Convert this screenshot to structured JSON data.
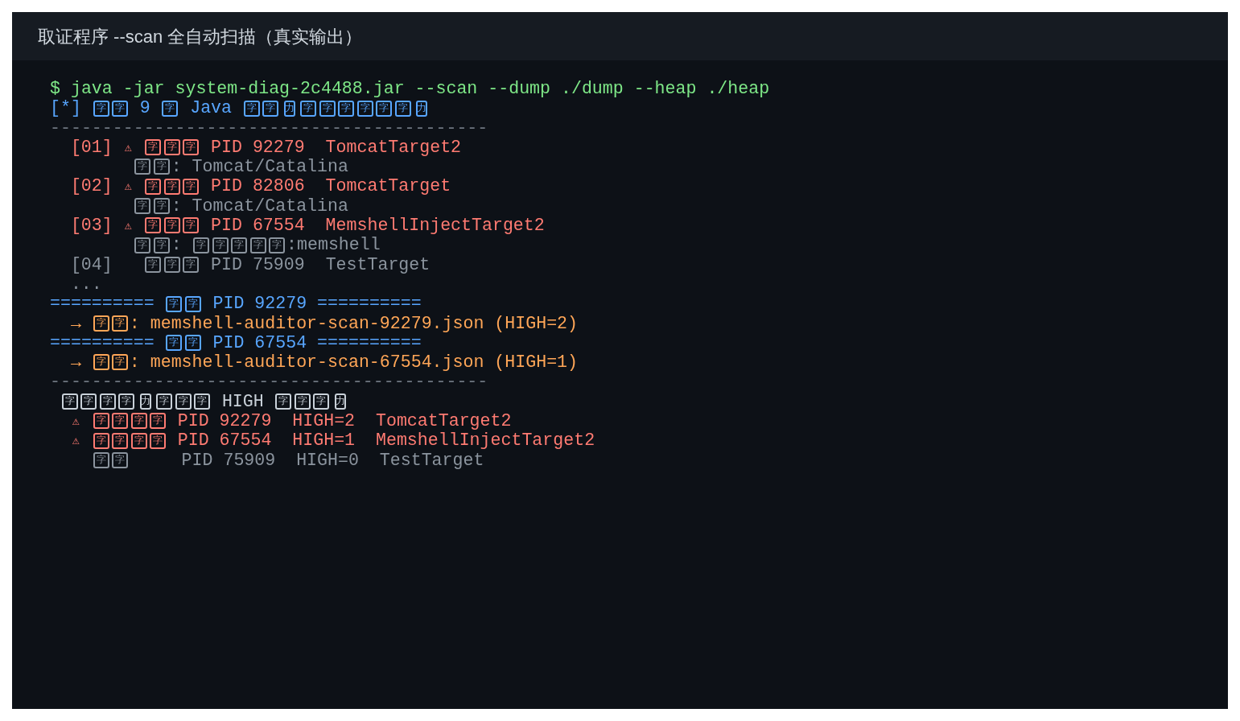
{
  "window": {
    "title": "取证程序 --scan 全自动扫描（真实输出）"
  },
  "terminal": {
    "lines": [
      {
        "kind": "command",
        "parts": [
          {
            "kind": "text",
            "text": "$ java -jar system-diag-2c4488.jar --scan --dump ./dump --heap ./heap"
          }
        ]
      },
      {
        "kind": "info",
        "parts": [
          {
            "kind": "text",
            "text": "[*] "
          },
          {
            "kind": "missing-glyph",
            "text": "字字"
          },
          {
            "kind": "text",
            "text": " 9 "
          },
          {
            "kind": "missing-glyph",
            "text": "字"
          },
          {
            "kind": "text",
            "text": " Java "
          },
          {
            "kind": "missing-glyph",
            "text": "字字"
          },
          {
            "kind": "narrow-glyph",
            "text": "力"
          },
          {
            "kind": "missing-glyph",
            "text": "字字字字字字"
          },
          {
            "kind": "narrow-glyph",
            "text": "力"
          }
        ]
      },
      {
        "kind": "rule",
        "parts": [
          {
            "kind": "text",
            "text": "------------------------------------------"
          }
        ]
      },
      {
        "kind": "alert-entry",
        "parts": [
          {
            "kind": "text",
            "text": "[01] "
          },
          {
            "kind": "symbol",
            "text": "⚠"
          },
          {
            "kind": "missing-glyph",
            "text": "字字字"
          },
          {
            "kind": "text",
            "text": " PID 92279  TomcatTarget2"
          }
        ]
      },
      {
        "kind": "detail",
        "parts": [
          {
            "kind": "missing-glyph",
            "text": "字字"
          },
          {
            "kind": "text",
            "text": ": Tomcat/Catalina"
          }
        ]
      },
      {
        "kind": "alert-entry",
        "parts": [
          {
            "kind": "text",
            "text": "[02] "
          },
          {
            "kind": "symbol",
            "text": "⚠"
          },
          {
            "kind": "missing-glyph",
            "text": "字字字"
          },
          {
            "kind": "text",
            "text": " PID 82806  TomcatTarget"
          }
        ]
      },
      {
        "kind": "detail",
        "parts": [
          {
            "kind": "missing-glyph",
            "text": "字字"
          },
          {
            "kind": "text",
            "text": ": Tomcat/Catalina"
          }
        ]
      },
      {
        "kind": "alert-entry",
        "parts": [
          {
            "kind": "text",
            "text": "[03] "
          },
          {
            "kind": "symbol",
            "text": "⚠"
          },
          {
            "kind": "missing-glyph",
            "text": "字字字"
          },
          {
            "kind": "text",
            "text": " PID 67554  MemshellInjectTarget2"
          }
        ]
      },
      {
        "kind": "detail",
        "parts": [
          {
            "kind": "missing-glyph",
            "text": "字字"
          },
          {
            "kind": "text",
            "text": ": "
          },
          {
            "kind": "missing-glyph",
            "text": "字字字字字"
          },
          {
            "kind": "text",
            "text": ":memshell"
          }
        ]
      },
      {
        "kind": "entry",
        "parts": [
          {
            "kind": "text",
            "text": "[04]   "
          },
          {
            "kind": "missing-glyph",
            "text": "字字字"
          },
          {
            "kind": "text",
            "text": " PID 75909  TestTarget"
          }
        ]
      },
      {
        "kind": "more",
        "parts": [
          {
            "kind": "text",
            "text": "..."
          }
        ]
      },
      {
        "kind": "section",
        "parts": [
          {
            "kind": "text",
            "text": "========== "
          },
          {
            "kind": "missing-glyph",
            "text": "字字"
          },
          {
            "kind": "text",
            "text": " PID 92279 =========="
          }
        ]
      },
      {
        "kind": "output",
        "parts": [
          {
            "kind": "text",
            "text": "→ "
          },
          {
            "kind": "missing-glyph",
            "text": "字字"
          },
          {
            "kind": "text",
            "text": ": memshell-auditor-scan-92279.json (HIGH=2)"
          }
        ]
      },
      {
        "kind": "section",
        "parts": [
          {
            "kind": "text",
            "text": "========== "
          },
          {
            "kind": "missing-glyph",
            "text": "字字"
          },
          {
            "kind": "text",
            "text": " PID 67554 =========="
          }
        ]
      },
      {
        "kind": "output",
        "parts": [
          {
            "kind": "text",
            "text": "→ "
          },
          {
            "kind": "missing-glyph",
            "text": "字字"
          },
          {
            "kind": "text",
            "text": ": memshell-auditor-scan-67554.json (HIGH=1)"
          }
        ]
      },
      {
        "kind": "rule",
        "parts": [
          {
            "kind": "text",
            "text": "------------------------------------------"
          }
        ]
      },
      {
        "kind": "heading",
        "parts": [
          {
            "kind": "missing-glyph",
            "text": "字字字字"
          },
          {
            "kind": "narrow-glyph",
            "text": "力"
          },
          {
            "kind": "missing-glyph",
            "text": "字字字"
          },
          {
            "kind": "text",
            "text": " HIGH "
          },
          {
            "kind": "missing-glyph",
            "text": "字字字"
          },
          {
            "kind": "narrow-glyph",
            "text": "力"
          }
        ]
      },
      {
        "kind": "alert-summary",
        "parts": [
          {
            "kind": "symbol",
            "text": "⚠"
          },
          {
            "kind": "missing-glyph",
            "text": "字字字字"
          },
          {
            "kind": "text",
            "text": " PID 92279  HIGH=2  TomcatTarget2"
          }
        ]
      },
      {
        "kind": "alert-summary",
        "parts": [
          {
            "kind": "symbol",
            "text": "⚠"
          },
          {
            "kind": "missing-glyph",
            "text": "字字字字"
          },
          {
            "kind": "text",
            "text": " PID 67554  HIGH=1  MemshellInjectTarget2"
          }
        ]
      },
      {
        "kind": "summary",
        "parts": [
          {
            "kind": "missing-glyph",
            "text": "字字"
          },
          {
            "kind": "text",
            "text": "     PID 75909  HIGH=0  TestTarget"
          }
        ]
      }
    ]
  }
}
